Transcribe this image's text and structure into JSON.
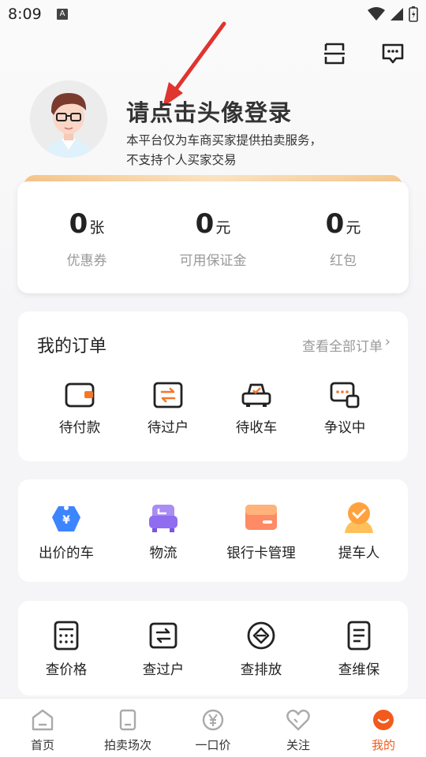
{
  "status_bar": {
    "time": "8:09",
    "notification_icon": "A"
  },
  "header": {
    "scan_icon": "scan-icon",
    "message_icon": "message-icon",
    "login_title": "请点击头像登录",
    "login_desc_line1": "本平台仅为车商买家提供拍卖服务，",
    "login_desc_line2": "不支持个人买家交易"
  },
  "wallet": {
    "items": [
      {
        "value": "0",
        "unit": "张",
        "label": "优惠券"
      },
      {
        "value": "0",
        "unit": "元",
        "label": "可用保证金"
      },
      {
        "value": "0",
        "unit": "元",
        "label": "红包"
      }
    ]
  },
  "orders": {
    "title": "我的订单",
    "view_all": "查看全部订单",
    "items": [
      {
        "label": "待付款",
        "icon": "wallet-icon"
      },
      {
        "label": "待过户",
        "icon": "transfer-icon"
      },
      {
        "label": "待收车",
        "icon": "car-icon"
      },
      {
        "label": "争议中",
        "icon": "dispute-icon"
      }
    ]
  },
  "services": {
    "items": [
      {
        "label": "出价的车",
        "icon": "price-tag-icon"
      },
      {
        "label": "物流",
        "icon": "logistics-icon"
      },
      {
        "label": "银行卡管理",
        "icon": "bank-card-icon"
      },
      {
        "label": "提车人",
        "icon": "pickup-person-icon"
      }
    ]
  },
  "tools": {
    "items": [
      {
        "label": "查价格",
        "icon": "calculator-icon"
      },
      {
        "label": "查过户",
        "icon": "transfer-check-icon"
      },
      {
        "label": "查排放",
        "icon": "emission-icon"
      },
      {
        "label": "查维保",
        "icon": "maintenance-icon"
      }
    ]
  },
  "tabbar": {
    "items": [
      {
        "label": "首页",
        "icon": "home-icon",
        "active": false
      },
      {
        "label": "拍卖场次",
        "icon": "auction-icon",
        "active": false
      },
      {
        "label": "一口价",
        "icon": "yen-icon",
        "active": false
      },
      {
        "label": "关注",
        "icon": "heart-icon",
        "active": false
      },
      {
        "label": "我的",
        "icon": "profile-icon",
        "active": true
      }
    ]
  },
  "colors": {
    "accent": "#f25a1e",
    "wallet_band": "#f6c58a"
  }
}
